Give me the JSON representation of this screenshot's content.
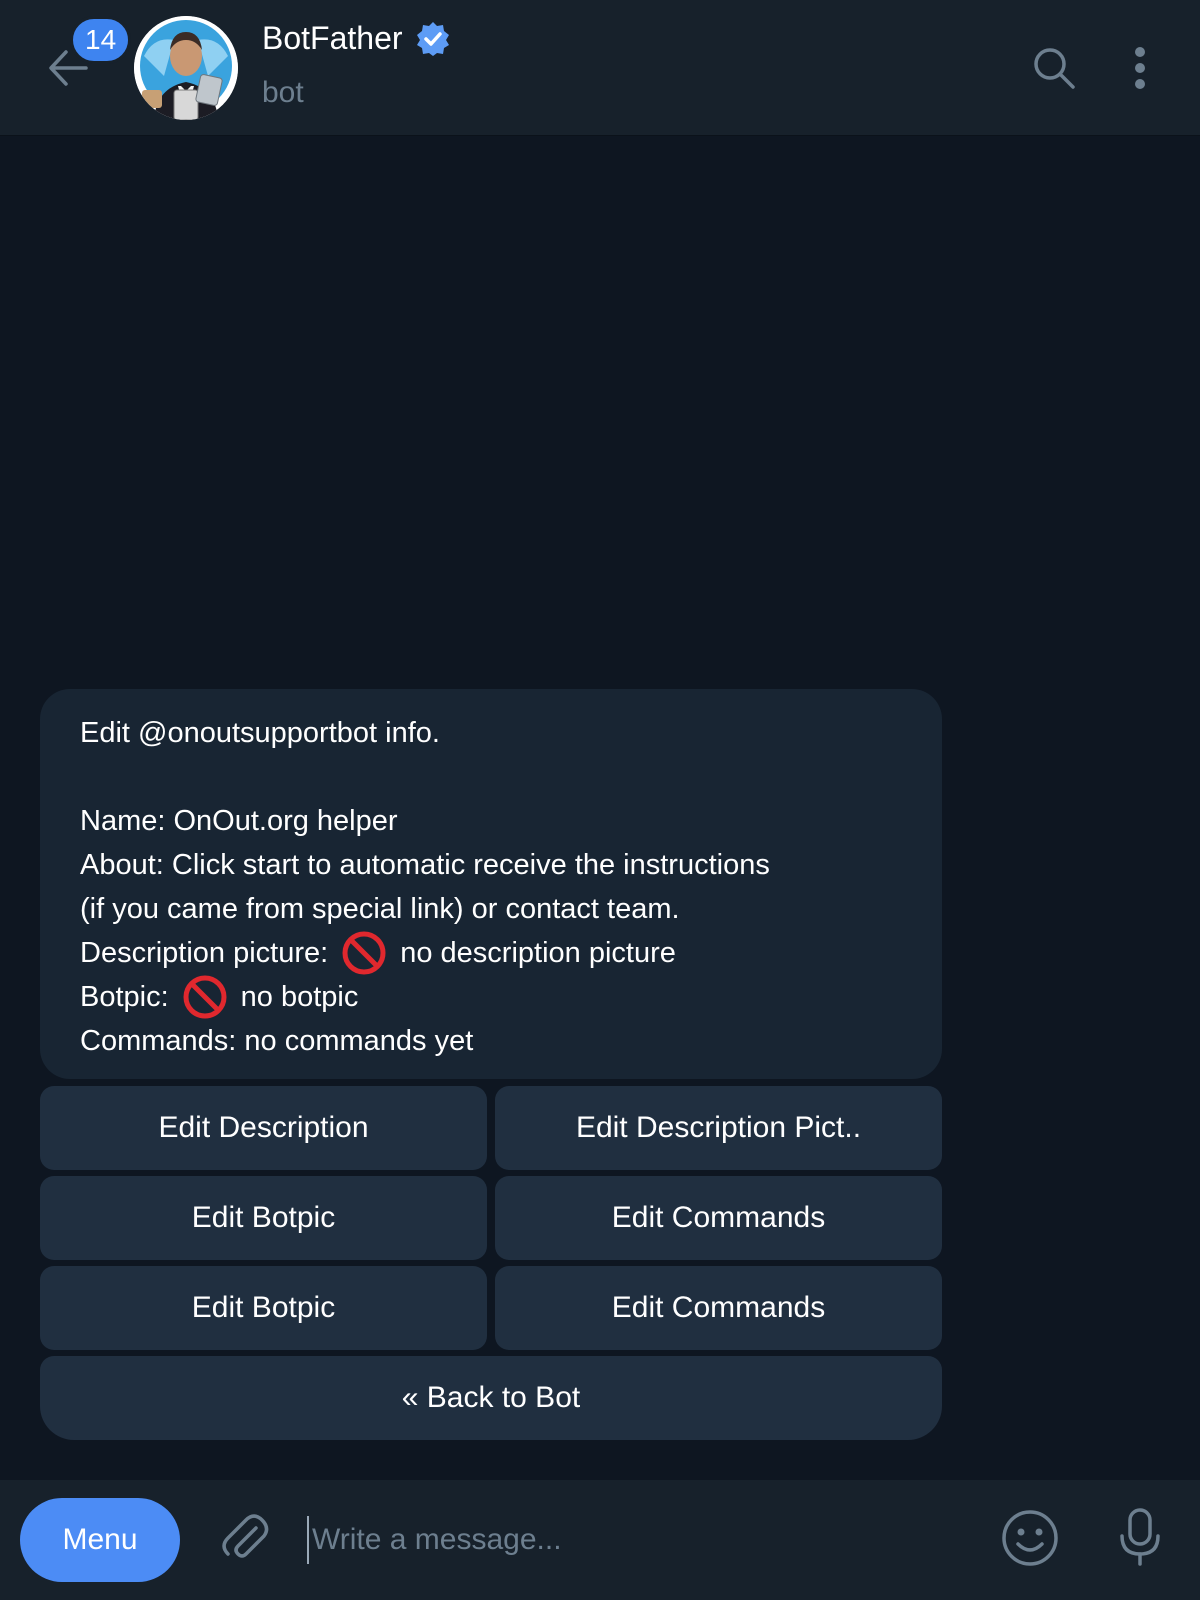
{
  "header": {
    "unread_count": "14",
    "title": "BotFather",
    "subtitle": "bot",
    "icons": {
      "back": "arrow-left-icon",
      "verified": "verified-badge-icon",
      "search": "search-icon",
      "more": "more-vertical-icon"
    }
  },
  "message": {
    "line1": "Edit @onoutsupportbot info.",
    "name": "Name: OnOut.org helper",
    "about_1": "About: Click start to automatic receive the instructions",
    "about_2": "(if you came from special link) or contact team.",
    "desc_label": "Description picture:",
    "desc_value": "no description picture",
    "botpic_label": "Botpic:",
    "botpic_value": "no botpic",
    "commands": "Commands: no commands yet"
  },
  "keyboard": {
    "r1_left": "Edit Description",
    "r1_right": "Edit Description Pict..",
    "r2_left": "Edit Botpic",
    "r2_right": "Edit Commands",
    "r3_left": "Edit Botpic",
    "r3_right": "Edit Commands",
    "back": "« Back to Bot"
  },
  "composer": {
    "menu_label": "Menu",
    "placeholder": "Write a message...",
    "icons": {
      "attach": "paperclip-icon",
      "emoji": "smiley-icon",
      "mic": "microphone-icon"
    }
  },
  "colors": {
    "background": "#0e1621",
    "header": "#17212b",
    "bubble": "#182533",
    "keyboard_button": "#202f40",
    "accent": "#4c8cf5",
    "muted": "#6d7f8f"
  }
}
